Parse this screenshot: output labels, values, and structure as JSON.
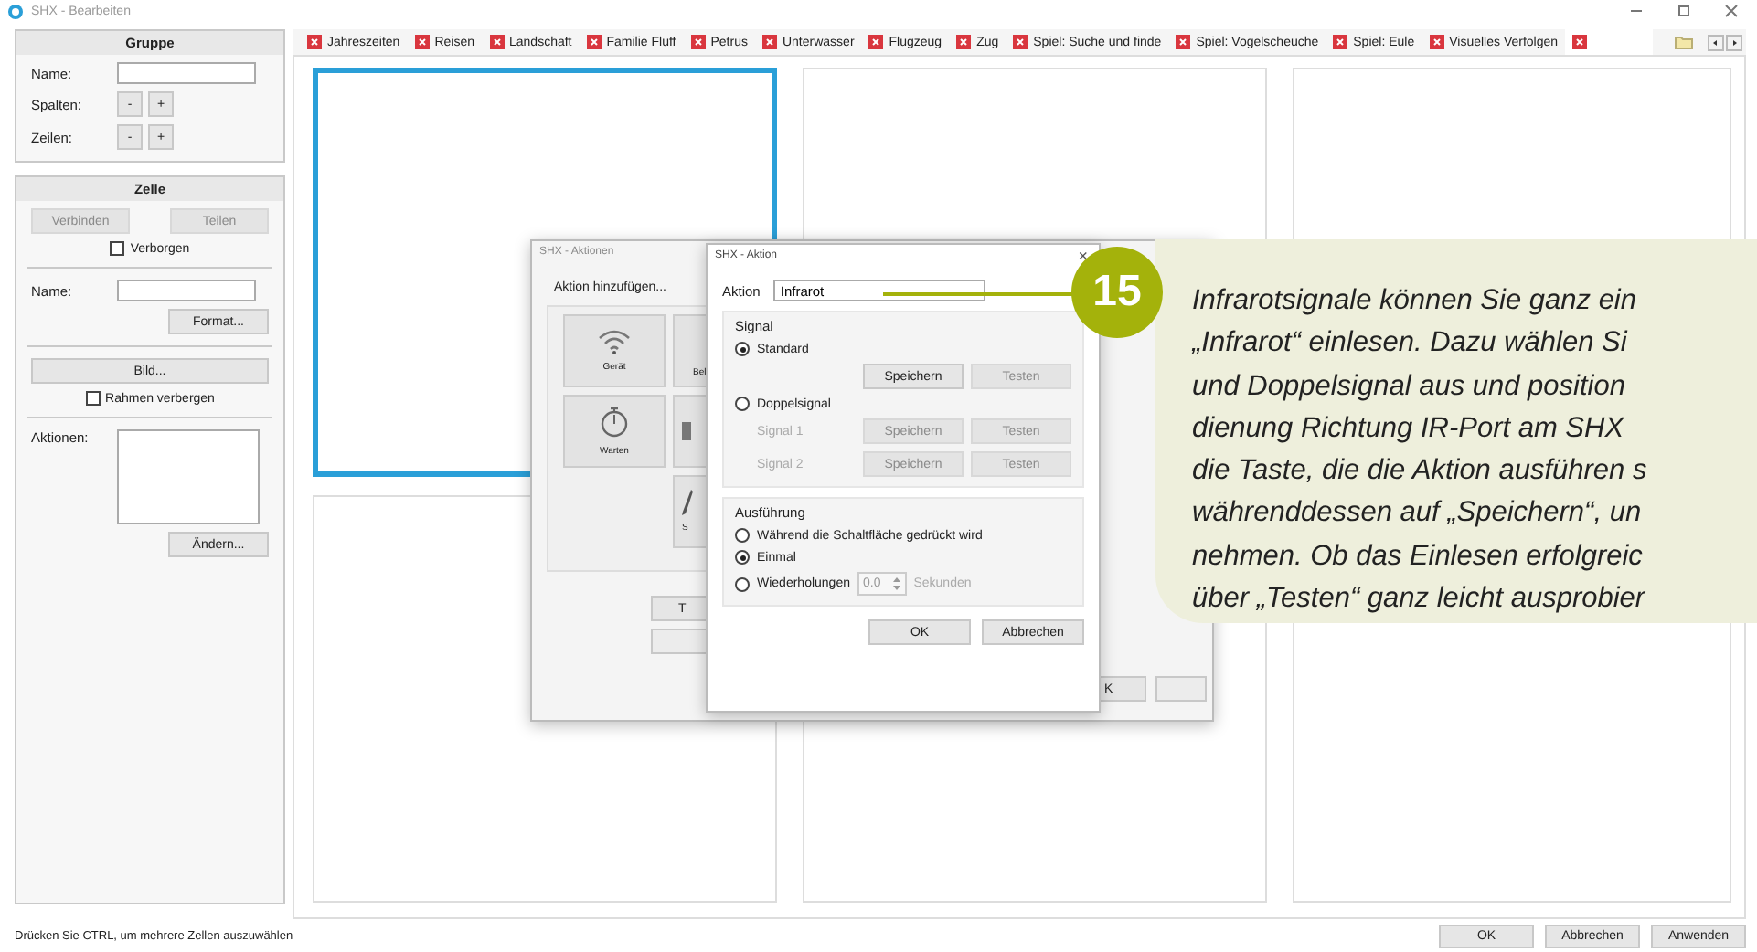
{
  "window": {
    "title": "SHX - Bearbeiten"
  },
  "group_panel": {
    "heading": "Gruppe",
    "name_label": "Name:",
    "columns_label": "Spalten:",
    "columns_buttons": [
      "-",
      "+"
    ],
    "rows_label": "Zeilen:",
    "rows_buttons": [
      "-",
      "+"
    ]
  },
  "cell_panel": {
    "heading": "Zelle",
    "buttons": [
      {
        "label": "Verbinden",
        "disabled": true
      },
      {
        "label": "Teilen",
        "disabled": true
      }
    ],
    "hidden_checkbox": {
      "label": "Verborgen",
      "checked": false
    },
    "name_label": "Name:",
    "format_button": "Format...",
    "image_button": "Bild...",
    "frame_checkbox": {
      "label": "Rahmen verbergen",
      "checked": false
    },
    "actions_label": "Aktionen:",
    "change_button": "Ändern..."
  },
  "tabs": [
    {
      "label": "Jahreszeiten",
      "selected": false
    },
    {
      "label": "Reisen",
      "selected": false
    },
    {
      "label": "Landschaft",
      "selected": false
    },
    {
      "label": "Familie Fluff",
      "selected": false
    },
    {
      "label": "Petrus",
      "selected": false
    },
    {
      "label": "Unterwasser",
      "selected": false
    },
    {
      "label": "Flugzeug",
      "selected": false
    },
    {
      "label": "Zug",
      "selected": false
    },
    {
      "label": "Spiel: Suche und finde",
      "selected": false
    },
    {
      "label": "Spiel: Vogelscheuche",
      "selected": false
    },
    {
      "label": "Spiel: Eule",
      "selected": false
    },
    {
      "label": "Visuelles Verfolgen",
      "selected": false
    },
    {
      "selected": true
    }
  ],
  "cells": [
    {
      "selected": true
    },
    {
      "selected": false
    },
    {
      "selected": false
    },
    {
      "selected": false
    },
    {
      "selected": false
    },
    {
      "selected": false
    }
  ],
  "actions_dialog": {
    "title": "SHX - Aktionen",
    "heading": "Aktion hinzufügen...",
    "tiles": [
      {
        "label": "Gerät",
        "kind": "wifi"
      },
      {
        "label": "Bel",
        "kind": "blank"
      },
      {
        "label": "Warten",
        "kind": "timer"
      },
      {
        "kind": "block"
      },
      {
        "label": "S",
        "kind": "pen"
      }
    ],
    "buttons": [
      {
        "label": "T"
      },
      {
        "kind": "blank"
      },
      {
        "label": "K"
      },
      {
        "kind": "blank"
      }
    ]
  },
  "action_dialog": {
    "title": "SHX - Aktion",
    "close": "×",
    "action_label": "Aktion",
    "action_value": "Infrarot",
    "signal": {
      "title": "Signal",
      "options": [
        {
          "label": "Standard",
          "selected": true
        },
        {
          "label": "Doppelsignal",
          "selected": false
        }
      ],
      "standard_buttons": [
        {
          "label": "Speichern",
          "disabled": false
        },
        {
          "label": "Testen",
          "disabled": true
        }
      ],
      "rows": [
        {
          "label": "Signal 1",
          "disabled": true,
          "buttons": [
            "Speichern",
            "Testen"
          ]
        },
        {
          "label": "Signal 2",
          "disabled": true,
          "buttons": [
            "Speichern",
            "Testen"
          ]
        }
      ]
    },
    "execution": {
      "title": "Ausführung",
      "options": [
        {
          "label": "Während die Schaltfläche gedrückt wird",
          "selected": false
        },
        {
          "label": "Einmal",
          "selected": true
        },
        {
          "label": "Wiederholungen",
          "selected": false
        }
      ],
      "repeat_value": "0.0",
      "unit": "Sekunden",
      "repeat_disabled": true
    },
    "buttons": [
      "OK",
      "Abbrechen"
    ]
  },
  "callout": {
    "number": "15",
    "lines": [
      "Infrarotsignale können Sie ganz ein",
      "„Infrarot“ einlesen. Dazu wählen Si",
      "und Doppelsignal aus und position",
      "dienung Richtung IR-Port am SHX",
      "die Taste, die die Aktion ausführen s",
      "währenddessen auf „Speichern“, un",
      "nehmen. Ob das Einlesen erfolgreic",
      "über „Testen“ ganz leicht ausprobier"
    ]
  },
  "status_bar": {
    "hint": "Drücken Sie CTRL, um mehrere Zellen auszuwählen",
    "buttons": [
      "OK",
      "Abbrechen",
      "Anwenden"
    ]
  }
}
